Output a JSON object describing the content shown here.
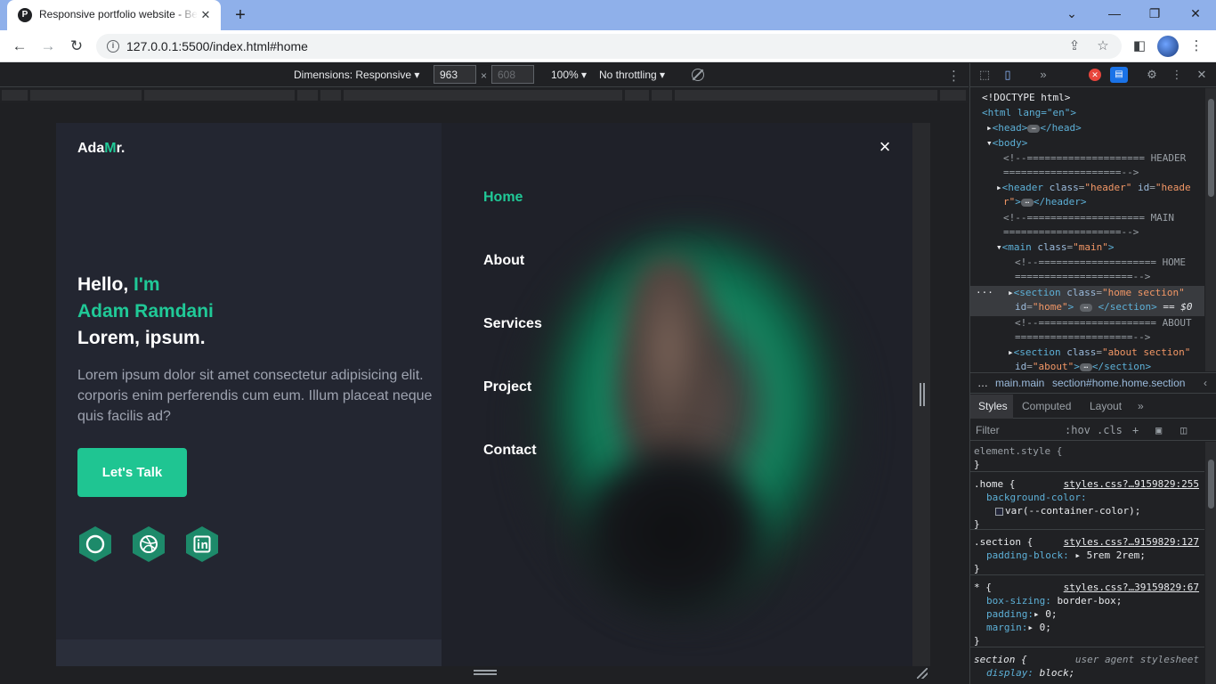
{
  "browser": {
    "tab_title": "Responsive portfolio website - Be",
    "tab_favicon": "P",
    "url": "127.0.0.1:5500/index.html#home"
  },
  "device_toolbar": {
    "dimensions_label": "Dimensions: Responsive",
    "width": "963",
    "height": "608",
    "zoom": "100%",
    "throttling": "No throttling"
  },
  "site": {
    "logo_main": "Ada",
    "logo_accent": "M",
    "logo_end": "r.",
    "hello": "Hello, ",
    "im": "I'm",
    "name": "Adam Ramdani",
    "tagline": "Lorem, ipsum.",
    "desc_line1": "Lorem ipsum dolor sit amet consectetur adipisicing elit.",
    "desc_line2": "corporis enim perferendis cum eum. Illum placeat neque",
    "desc_line3": "quis facilis ad?",
    "cta": "Let's Talk",
    "socials": [
      "github-icon",
      "dribbble-icon",
      "linkedin-icon"
    ],
    "accent_color": "#20c997"
  },
  "menu": {
    "items": [
      "Home",
      "About",
      "Services",
      "Project",
      "Contact"
    ],
    "active": "Home",
    "close": "×"
  },
  "devtools": {
    "elements": {
      "doctype": "<!DOCTYPE html>",
      "html_open": "<html lang=\"en\">",
      "head": "<head>",
      "head_close": "</head>",
      "body": "<body>",
      "c_header_1": "<!--==================== HEADER",
      "c_header_2": "====================-->",
      "header_1": "<header class=\"header\" id=\"heade",
      "header_2": "r\">",
      "header_close": "</header>",
      "c_main_1": "<!--==================== MAIN",
      "c_main_2": "====================-->",
      "main": "<main class=\"main\">",
      "c_home_1": "<!--==================== HOME",
      "c_home_2": "====================-->",
      "section_home_1": "<section class=\"home section\"",
      "section_home_2": "id=\"home\">",
      "section_close": "</section>",
      "eq": "== $0",
      "c_about_1": "<!--==================== ABOUT",
      "c_about_2": "====================-->",
      "section_about_1": "<section class=\"about section\"",
      "section_about_2": "id=\"about\">"
    },
    "breadcrumbs": [
      "…",
      "main.main",
      "section#home.home.section"
    ],
    "style_tabs": [
      "Styles",
      "Computed",
      "Layout"
    ],
    "filter_placeholder": "Filter",
    "hov": ":hov",
    "cls": ".cls",
    "rules": {
      "element_style": "element.style {",
      "close": "}",
      "home_sel": ".home {",
      "home_src": "styles.css?…9159829:255",
      "home_prop": "background-color:",
      "home_val": "var(--container-color);",
      "section_sel": ".section {",
      "section_src": "styles.css?…9159829:127",
      "section_prop": "padding-block:",
      "section_val": "5rem 2rem;",
      "star_sel": "* {",
      "star_src": "styles.css?…39159829:67",
      "star_p1": "box-sizing:",
      "star_v1": "border-box;",
      "star_p2": "padding:",
      "star_v2": "0;",
      "star_p3": "margin:",
      "star_v3": "0;",
      "ua_sel": "section {",
      "ua_src": "user agent stylesheet",
      "ua_prop": "display:",
      "ua_val": "block;"
    }
  }
}
